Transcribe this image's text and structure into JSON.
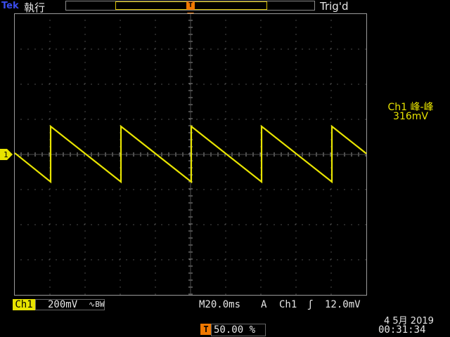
{
  "header": {
    "brand": "Tek",
    "run_state": "執行",
    "trigger_status": "Trig'd",
    "trigger_marker": "T"
  },
  "channel": {
    "ground_marker": "1",
    "color": "#e8e400"
  },
  "measurement": {
    "label": "Ch1 峰-峰",
    "value": "316mV"
  },
  "status_bar": {
    "channel": "Ch1",
    "scale": "200mV",
    "bandwidth_icon": "∿BW",
    "timebase": "M20.0ms",
    "trigger_mode": "A",
    "trigger_source": "Ch1",
    "slope_icon": "rising-edge-icon",
    "slope_glyph": "ʃ",
    "trigger_level": "12.0mV",
    "trigger_position_marker": "T",
    "trigger_position": "50.00 %",
    "date": "4 5月 2019",
    "time": "00:31:34"
  },
  "waveform": {
    "type": "sawtooth",
    "period_divisions": 2,
    "peak_to_peak_divisions": 1.58,
    "high_level_divisions": 0.4,
    "low_level_divisions": -1.18,
    "colors": {
      "trace": "#e8e400",
      "grid": "#9a9a9a",
      "trigger": "#f07800"
    }
  }
}
